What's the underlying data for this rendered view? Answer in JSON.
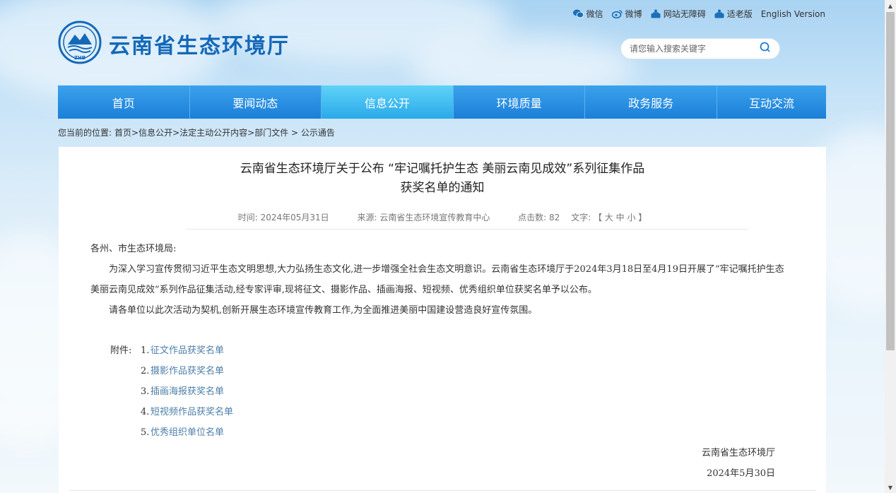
{
  "toplinks": [
    {
      "label": "微信",
      "icon": "wechat-icon"
    },
    {
      "label": "微博",
      "icon": "weibo-icon"
    },
    {
      "label": "网站无障碍",
      "icon": "accessibility-icon"
    },
    {
      "label": "适老版",
      "icon": "elderly-mode-icon"
    },
    {
      "label": "English Version",
      "icon": ""
    }
  ],
  "logo": {
    "title": "云南省生态环境厅",
    "emblem_text": "ZHB"
  },
  "search": {
    "placeholder": "请您输入搜索关键字"
  },
  "nav": {
    "items": [
      "首页",
      "要闻动态",
      "信息公开",
      "环境质量",
      "政务服务",
      "互动交流"
    ],
    "active": 2
  },
  "breadcrumb": {
    "prefix": "您当前的位置:",
    "path": "首页>信息公开>法定主动公开内容>部门文件 > 公示通告"
  },
  "article": {
    "title_line1": "云南省生态环境厅关于公布 “牢记嘱托护生态 美丽云南见成效”系列征集作品",
    "title_line2": "获奖名单的通知",
    "meta": {
      "time": "时间: 2024年05月31日",
      "source": "来源: 云南省生态环境宣传教育中心",
      "clicks": "点击数: 82",
      "fontsize": "文字: 【 大 中 小 】"
    },
    "salutation": "各州、市生态环境局:",
    "para1": "为深入学习宣传贯彻习近平生态文明思想,大力弘扬生态文化,进一步增强全社会生态文明意识。云南省生态环境厅于2024年3月18日至4月19日开展了“牢记嘱托护生态 美丽云南见成效”系列作品征集活动,经专家评审,现将征文、摄影作品、插画海报、短视频、优秀组织单位获奖名单予以公布。",
    "para2": "请各单位以此次活动为契机,创新开展生态环境宣传教育工作,为全面推进美丽中国建设营造良好宣传氛围。",
    "attach_label": "附件:",
    "attachments": [
      {
        "num": "1.",
        "label": "征文作品获奖名单"
      },
      {
        "num": "2.",
        "label": "摄影作品获奖名单"
      },
      {
        "num": "3.",
        "label": "插画海报获奖名单"
      },
      {
        "num": "4.",
        "label": "短视频作品获奖名单"
      },
      {
        "num": "5.",
        "label": "优秀组织单位名单"
      }
    ],
    "signature": "云南省生态环境厅",
    "date": "2024年5月30日"
  },
  "colors": {
    "brand": "#1368b8",
    "nav": "#1b7fd8",
    "nav_active": "#2aa9ea",
    "link": "#4d7ea8"
  }
}
